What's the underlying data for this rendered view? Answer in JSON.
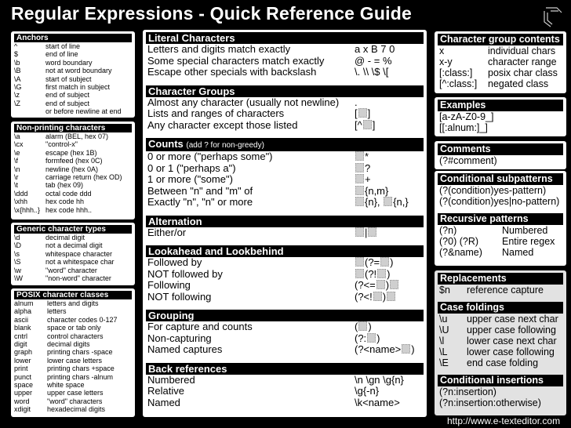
{
  "title": "Regular Expressions - Quick Reference Guide",
  "logo_icon": "e-texteditor-logo-icon",
  "footer_url": "http://www.e-texteditor.com",
  "left": {
    "anchors": {
      "header": "Anchors",
      "rows": [
        {
          "k": "^",
          "v": "start of line"
        },
        {
          "k": "$",
          "v": "end of line"
        },
        {
          "k": "\\b",
          "v": "word boundary"
        },
        {
          "k": "\\B",
          "v": "not at word boundary"
        },
        {
          "k": "\\A",
          "v": "start of subject"
        },
        {
          "k": "\\G",
          "v": "first match in subject"
        },
        {
          "k": "\\z",
          "v": "end of subject"
        },
        {
          "k": "\\Z",
          "v": "end of subject"
        },
        {
          "k": "",
          "v": "or before newline at end"
        }
      ]
    },
    "nonprinting": {
      "header": "Non-printing characters",
      "rows": [
        {
          "k": "\\a",
          "v": "alarm (BEL, hex 07)"
        },
        {
          "k": "\\cx",
          "v": "\"control-x\""
        },
        {
          "k": "\\e",
          "v": "escape (hex 1B)"
        },
        {
          "k": "\\f",
          "v": "formfeed (hex 0C)"
        },
        {
          "k": "\\n",
          "v": "newline (hex 0A)"
        },
        {
          "k": "\\r",
          "v": "carriage return (hex OD)"
        },
        {
          "k": "\\t",
          "v": "tab (hex 09)"
        },
        {
          "k": "\\ddd",
          "v": "octal code ddd"
        },
        {
          "k": "\\xhh",
          "v": "hex code hh"
        },
        {
          "k": "\\x{hhh..}",
          "v": "hex code hhh.."
        }
      ]
    },
    "generic": {
      "header": "Generic character types",
      "rows": [
        {
          "k": "\\d",
          "v": "decimal digit"
        },
        {
          "k": "\\D",
          "v": "not a decimal digit"
        },
        {
          "k": "\\s",
          "v": "whitespace character"
        },
        {
          "k": "\\S",
          "v": "not a whitespace char"
        },
        {
          "k": "\\w",
          "v": "\"word\" character"
        },
        {
          "k": "\\W",
          "v": "\"non-word\" character"
        }
      ]
    },
    "posix": {
      "header": "POSIX character classes",
      "rows": [
        {
          "k": "alnum",
          "v": "letters and digits"
        },
        {
          "k": "alpha",
          "v": "letters"
        },
        {
          "k": "ascii",
          "v": "character codes 0-127"
        },
        {
          "k": "blank",
          "v": "space or tab only"
        },
        {
          "k": "cntrl",
          "v": "control characters"
        },
        {
          "k": "digit",
          "v": "decimal digits"
        },
        {
          "k": "graph",
          "v": "printing chars -space"
        },
        {
          "k": "lower",
          "v": "lower case letters"
        },
        {
          "k": "print",
          "v": "printing chars +space"
        },
        {
          "k": "punct",
          "v": "printing chars -alnum"
        },
        {
          "k": "space",
          "v": "white space"
        },
        {
          "k": "upper",
          "v": "upper case letters"
        },
        {
          "k": "word",
          "v": "\"word\" characters"
        },
        {
          "k": "xdigit",
          "v": "hexadecimal digits"
        }
      ]
    }
  },
  "middle": {
    "literal": {
      "header": "Literal Characters",
      "rows": [
        {
          "d": "Letters and digits match exactly",
          "s": "a x B 7 0"
        },
        {
          "d": "Some special characters match exactly",
          "s": "@ - = %"
        },
        {
          "d": "Escape other specials with backslash",
          "s": "\\. \\\\ \\$ \\["
        }
      ]
    },
    "groups": {
      "header": "Character Groups",
      "rows": [
        {
          "d": "Almost any character (usually not newline)",
          "s": "."
        },
        {
          "d": "Lists and ranges of characters",
          "s": "[▒]"
        },
        {
          "d": "Any character except those listed",
          "s": "[^▒]"
        }
      ]
    },
    "counts": {
      "header": "Counts",
      "sub": "(add ? for non-greedy)",
      "rows": [
        {
          "d": "0 or more (\"perhaps some\")",
          "s": "▒*"
        },
        {
          "d": "0 or 1 (\"perhaps a\")",
          "s": "▒?"
        },
        {
          "d": "1 or more (\"some\")",
          "s": "▒+"
        },
        {
          "d": "Between \"n\" and \"m\" of",
          "s": "▒{n,m}"
        },
        {
          "d": "Exactly \"n\", \"n\" or more",
          "s": "▒{n}, ▒{n,}"
        }
      ]
    },
    "alternation": {
      "header": "Alternation",
      "rows": [
        {
          "d": "Either/or",
          "s": "▒|▒"
        }
      ]
    },
    "lookaround": {
      "header": "Lookahead and Lookbehind",
      "rows": [
        {
          "d": "Followed by",
          "s": "▒(?=▒)"
        },
        {
          "d": "NOT followed by",
          "s": "▒(?!▒)"
        },
        {
          "d": "Following",
          "s": "(?<=▒)▒"
        },
        {
          "d": "NOT following",
          "s": "(?<!▒)▒"
        }
      ]
    },
    "grouping": {
      "header": "Grouping",
      "rows": [
        {
          "d": "For capture and counts",
          "s": "(▒)"
        },
        {
          "d": "Non-capturing",
          "s": "(?:▒)"
        },
        {
          "d": "Named captures",
          "s": "(?<name>▒)"
        }
      ]
    },
    "backrefs": {
      "header": "Back references",
      "rows": [
        {
          "d": "Numbered",
          "s": "\\n \\gn \\g{n}"
        },
        {
          "d": "Relative",
          "s": "\\g{-n}"
        },
        {
          "d": "Named",
          "s": "\\k<name>"
        }
      ]
    }
  },
  "right": {
    "cgc": {
      "header": "Character group contents",
      "rows": [
        {
          "k": "x",
          "v": "individual chars"
        },
        {
          "k": "x-y",
          "v": "character range"
        },
        {
          "k": "[:class:]",
          "v": "posix char class"
        },
        {
          "k": "[^:class:]",
          "v": "negated class"
        }
      ]
    },
    "examples": {
      "header": "Examples",
      "rows": [
        "[a-zA-Z0-9_]",
        "[[:alnum:]_]"
      ]
    },
    "comments": {
      "header": "Comments",
      "rows": [
        "(?#comment)"
      ]
    },
    "conditional": {
      "header": "Conditional subpatterns",
      "rows": [
        "(?(condition)yes-pattern)",
        "(?(condition)yes|no-pattern)"
      ]
    },
    "recursive": {
      "header": "Recursive patterns",
      "rows": [
        {
          "k": "(?n)",
          "v": "Numbered"
        },
        {
          "k": "(?0) (?R)",
          "v": "Entire regex"
        },
        {
          "k": "(?&name)",
          "v": "Named"
        }
      ]
    },
    "replacements": {
      "header": "Replacements",
      "rows": [
        {
          "k": "$n",
          "v": "reference capture"
        }
      ]
    },
    "casefold": {
      "header": "Case foldings",
      "rows": [
        {
          "k": "\\u",
          "v": "upper case next char"
        },
        {
          "k": "\\U",
          "v": "upper case following"
        },
        {
          "k": "\\l",
          "v": "lower case next char"
        },
        {
          "k": "\\L",
          "v": "lower case following"
        },
        {
          "k": "\\E",
          "v": "end case folding"
        }
      ]
    },
    "insertions": {
      "header": "Conditional insertions",
      "rows": [
        "(?n:insertion)",
        "(?n:insertion:otherwise)"
      ]
    }
  }
}
